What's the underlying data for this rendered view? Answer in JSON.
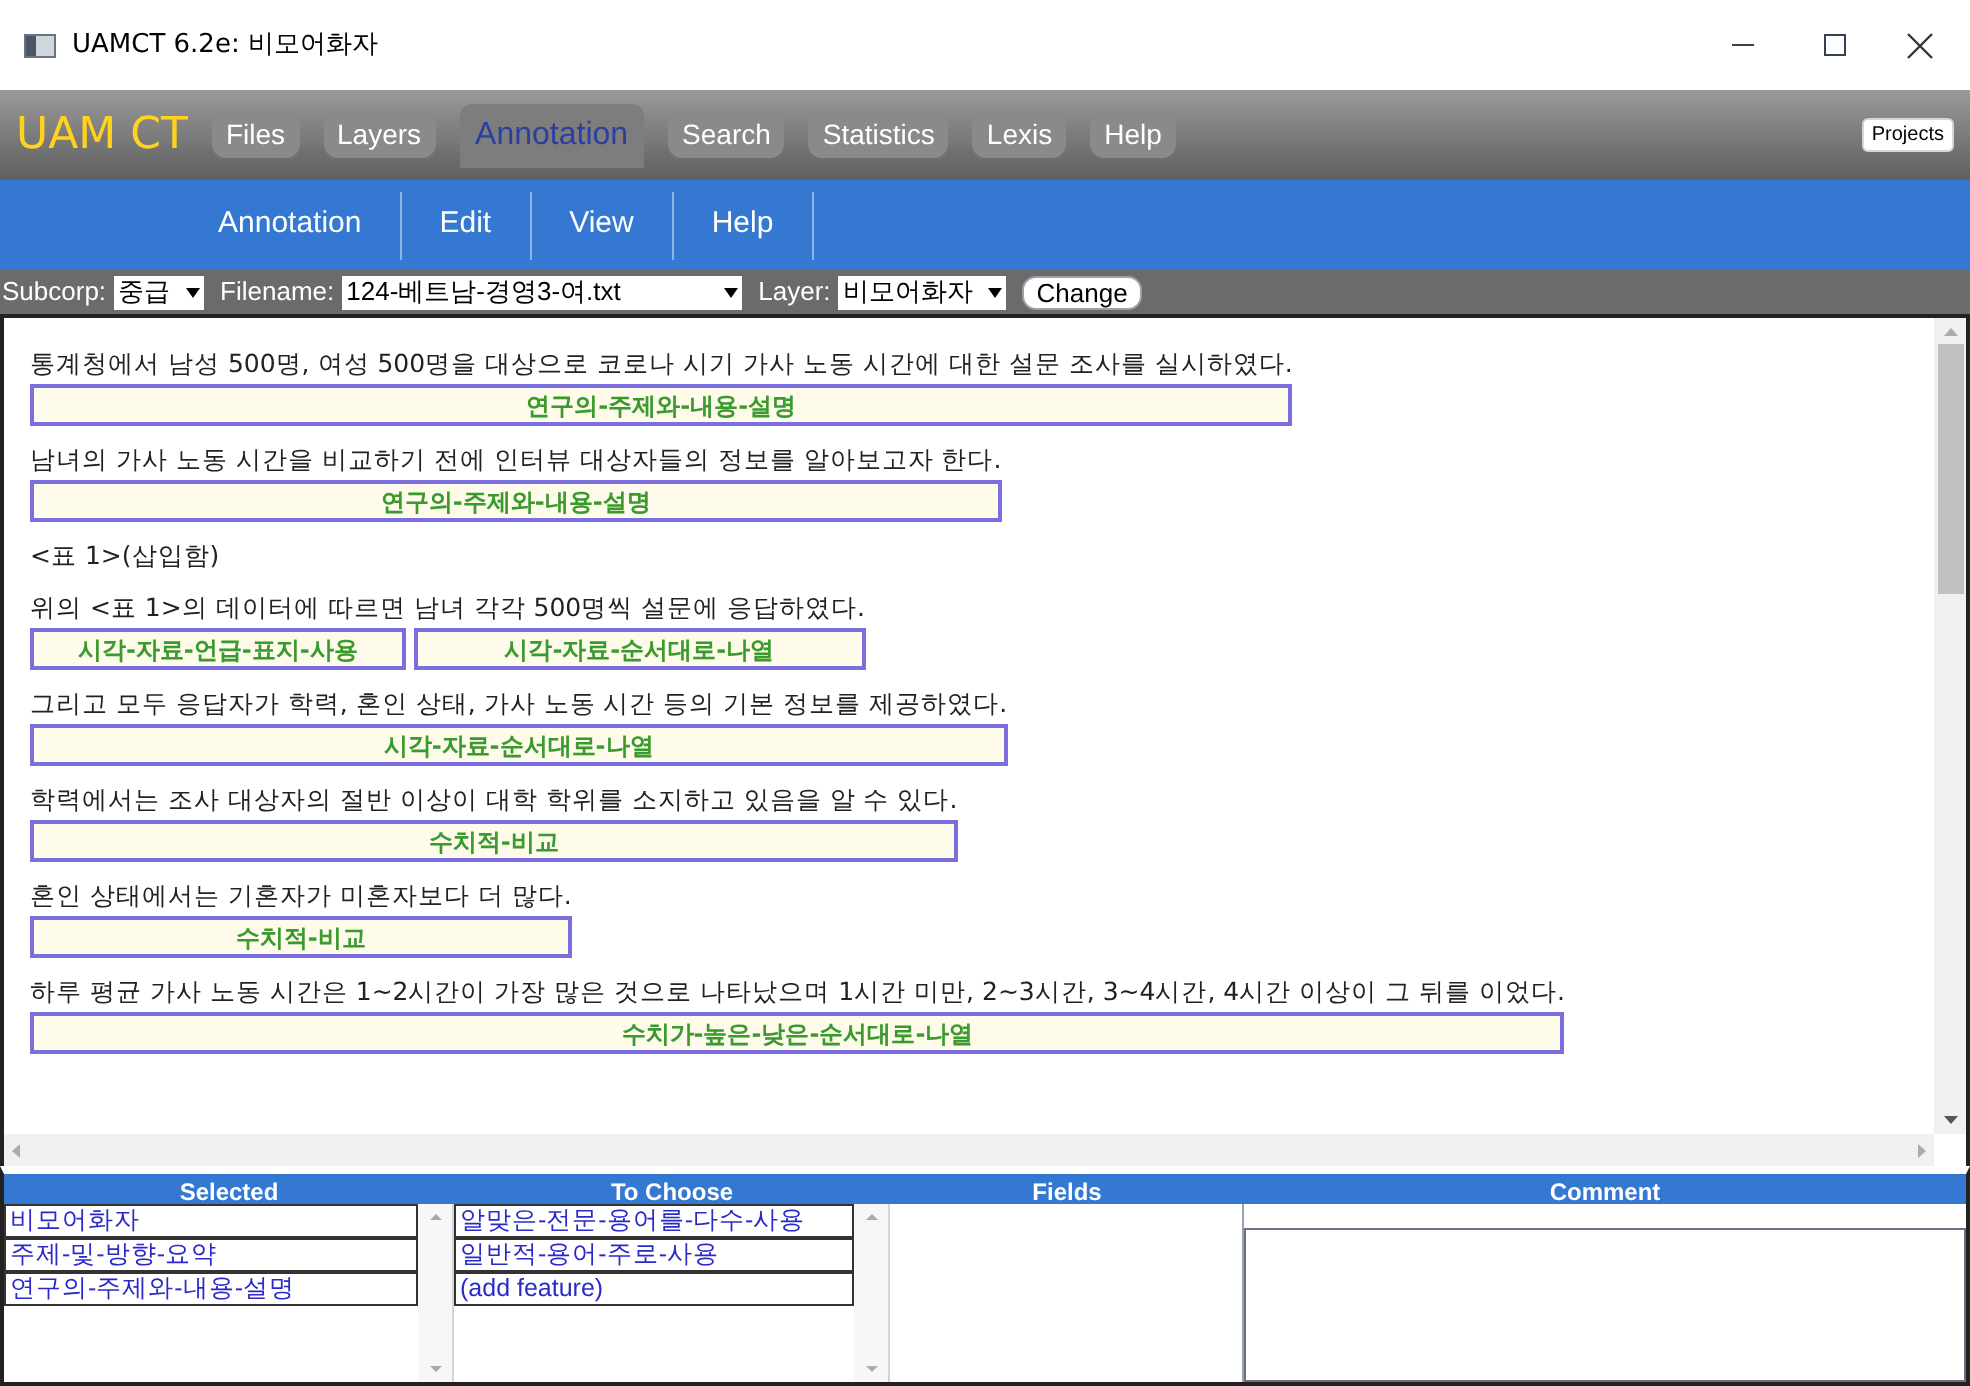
{
  "window": {
    "title": "UAMCT 6.2e: 비모어화자"
  },
  "app": {
    "logo": "UAM CT",
    "projects_button": "Projects"
  },
  "tabs": [
    {
      "label": "Files",
      "selected": false
    },
    {
      "label": "Layers",
      "selected": false
    },
    {
      "label": "Annotation",
      "selected": true
    },
    {
      "label": "Search",
      "selected": false
    },
    {
      "label": "Statistics",
      "selected": false
    },
    {
      "label": "Lexis",
      "selected": false
    },
    {
      "label": "Help",
      "selected": false
    }
  ],
  "submenu": [
    "Annotation",
    "Edit",
    "View",
    "Help"
  ],
  "toolbar": {
    "subcorp_label": "Subcorp:",
    "subcorp": "중급",
    "filename_label": "Filename:",
    "filename": "124-베트남-경영3-여.txt",
    "layer_label": "Layer:",
    "layer": "비모어화자",
    "change_button": "Change"
  },
  "document": [
    {
      "segments": [
        {
          "text": "통계청에서 남성 500명, 여성 500명을 대상으로 코로나 시기 가사 노동 시간에 대한 설문 조사를 실시하였다.",
          "tag": "연구의-주제와-내용-설명"
        }
      ]
    },
    {
      "segments": [
        {
          "text": "남녀의 가사 노동 시간을 비교하기 전에 인터뷰 대상자들의 정보를 알아보고자 한다.",
          "tag": "연구의-주제와-내용-설명"
        }
      ]
    },
    {
      "segments": [
        {
          "text": "<표 1>(삽입함)"
        }
      ]
    },
    {
      "segments": [
        {
          "text": "위의 <표 1>의 데이터에 따르면",
          "tag": "시각-자료-언급-표지-사용"
        },
        {
          "text": "남녀 각각 500명씩 설문에 응답하였다.",
          "tag": "시각-자료-순서대로-나열"
        }
      ]
    },
    {
      "segments": [
        {
          "text": "그리고 모두 응답자가 학력, 혼인 상태, 가사 노동 시간 등의 기본 정보를 제공하였다.",
          "tag": "시각-자료-순서대로-나열"
        }
      ]
    },
    {
      "segments": [
        {
          "text": "학력에서는 조사 대상자의 절반 이상이 대학 학위를 소지하고 있음을 알 수 있다.",
          "tag": "수치적-비교"
        }
      ]
    },
    {
      "segments": [
        {
          "text": "혼인 상태에서는 기혼자가 미혼자보다 더 많다.",
          "tag": "수치적-비교"
        }
      ]
    },
    {
      "segments": [
        {
          "text": "하루 평균 가사 노동 시간은 1~2시간이 가장 많은 것으로 나타났으며 1시간 미만, 2~3시간, 3~4시간, 4시간 이상이 그 뒤를 이었다.",
          "tag": "수치가-높은-낮은-순서대로-나열"
        }
      ]
    }
  ],
  "panel": {
    "headers": [
      "Selected",
      "To Choose",
      "Fields",
      "Comment"
    ],
    "selected": [
      "비모어화자",
      "주제-및-방향-요약",
      "연구의-주제와-내용-설명"
    ],
    "to_choose": [
      "알맞은-전문-용어를-다수-사용",
      "일반적-용어-주로-사용",
      "(add feature)"
    ]
  }
}
